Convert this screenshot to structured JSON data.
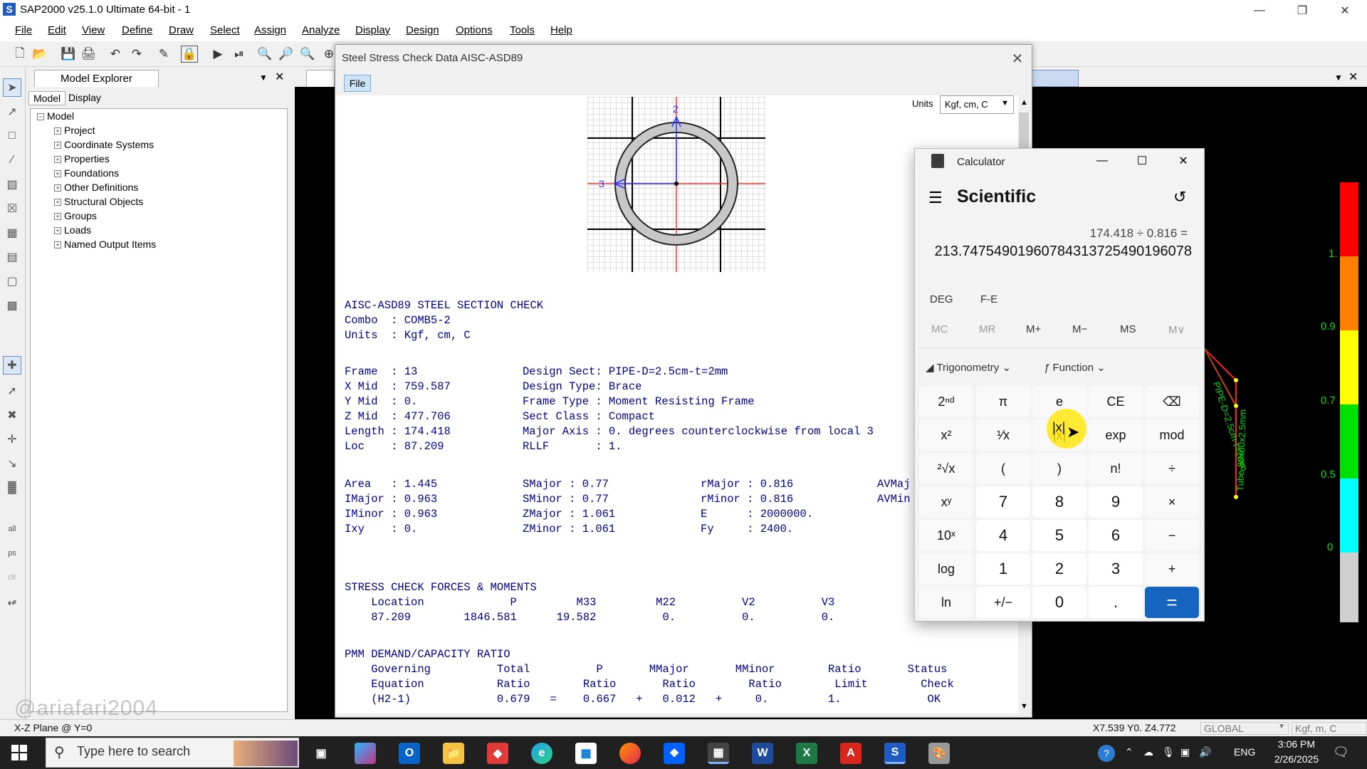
{
  "window": {
    "title": "SAP2000 v25.1.0 Ultimate 64-bit - 1",
    "app_icon_letter": "S"
  },
  "menu": [
    "File",
    "Edit",
    "View",
    "Define",
    "Draw",
    "Select",
    "Assign",
    "Analyze",
    "Display",
    "Design",
    "Options",
    "Tools",
    "Help"
  ],
  "explorer": {
    "title": "Model Explorer",
    "tabs": [
      "Model",
      "Display"
    ],
    "root": "Model",
    "items": [
      "Project",
      "Coordinate Systems",
      "Properties",
      "Foundations",
      "Other Definitions",
      "Structural Objects",
      "Groups",
      "Loads",
      "Named Output Items"
    ]
  },
  "dialog": {
    "title": "Steel Stress Check Data  AISC-ASD89",
    "file_button": "File",
    "units_label": "Units",
    "units_value": "Kgf, cm, C",
    "section_axis_labels": {
      "axis2": "2",
      "axis3": "3"
    },
    "header": [
      "AISC-ASD89 STEEL SECTION CHECK",
      "Combo  : COMB5-2",
      "Units  : Kgf, cm, C"
    ],
    "frame_left": [
      "Frame  : 13",
      "X Mid  : 759.587",
      "Y Mid  : 0.",
      "Z Mid  : 477.706",
      "Length : 174.418",
      "Loc    : 87.209"
    ],
    "frame_right": [
      "Design Sect: PIPE-D=2.5cm-t=2mm",
      "Design Type: Brace",
      "Frame Type : Moment Resisting Frame",
      "Sect Class : Compact",
      "Major Axis : 0. degrees counterclockwise from local 3",
      "RLLF       : 1."
    ],
    "props_col1": [
      "Area   : 1.445",
      "IMajor : 0.963",
      "IMinor : 0.963",
      "Ixy    : 0."
    ],
    "props_col2": [
      "SMajor : 0.77",
      "SMinor : 0.77",
      "ZMajor : 1.061",
      "ZMinor : 1.061"
    ],
    "props_col3": [
      "rMajor : 0.816",
      "rMinor : 0.816",
      "E      : 2000000.",
      "Fy     : 2400."
    ],
    "props_col4": [
      "AVMaj",
      "AVMin"
    ],
    "forces_title": "STRESS CHECK FORCES & MOMENTS",
    "forces_header": "    Location             P         M33         M22          V2          V3",
    "forces_row": "    87.209        1846.581      19.582          0.          0.          0.",
    "pmm_title": "PMM DEMAND/CAPACITY RATIO",
    "pmm_lines": [
      "    Governing          Total          P       MMajor       MMinor        Ratio       Status",
      "    Equation           Ratio        Ratio       Ratio        Ratio        Limit        Check",
      "    (H2-1)             0.679   =    0.667   +   0.012   +     0.         1.             OK"
    ]
  },
  "calculator": {
    "title": "Calculator",
    "mode": "Scientific",
    "expression": "174.418 ÷ 0.816 =",
    "result": "213.74754901960784313725490196078",
    "modes": [
      "DEG",
      "F-E"
    ],
    "memory": [
      "MC",
      "MR",
      "M+",
      "M−",
      "MS",
      "M∨"
    ],
    "functions": [
      "Trigonometry",
      "Function"
    ],
    "keys": [
      [
        "2ⁿᵈ",
        "π",
        "e",
        "CE",
        "⌫"
      ],
      [
        "x²",
        "¹⁄x",
        "|x|",
        "exp",
        "mod"
      ],
      [
        "²√x",
        "(",
        ")",
        "n!",
        "÷"
      ],
      [
        "xʸ",
        "7",
        "8",
        "9",
        "×"
      ],
      [
        "10ˣ",
        "4",
        "5",
        "6",
        "−"
      ],
      [
        "log",
        "1",
        "2",
        "3",
        "+"
      ],
      [
        "ln",
        "+/−",
        "0",
        ".",
        "="
      ]
    ]
  },
  "graph": {
    "legend_values": [
      "1.",
      "0.9",
      "0.7",
      "0.5",
      "0"
    ],
    "member_labels": [
      "Tube-80x80x2.5mm",
      "PIPE-D=2.5cm-t=2mm"
    ],
    "legend_colors": [
      "#ff0000",
      "#ff8000",
      "#ffff00",
      "#00e000",
      "#00ffff",
      "#cfcfcf"
    ]
  },
  "status": {
    "plane": "X-Z Plane @ Y=0",
    "coords": "X7.539  Y0.  Z4.772",
    "coord_system": "GLOBAL",
    "units": "Kgf, m, C"
  },
  "watermark": "@ariafari2004",
  "taskbar": {
    "search_placeholder": "Type here to search",
    "time": "3:06 PM",
    "date": "2/26/2025",
    "lang": "ENG"
  }
}
